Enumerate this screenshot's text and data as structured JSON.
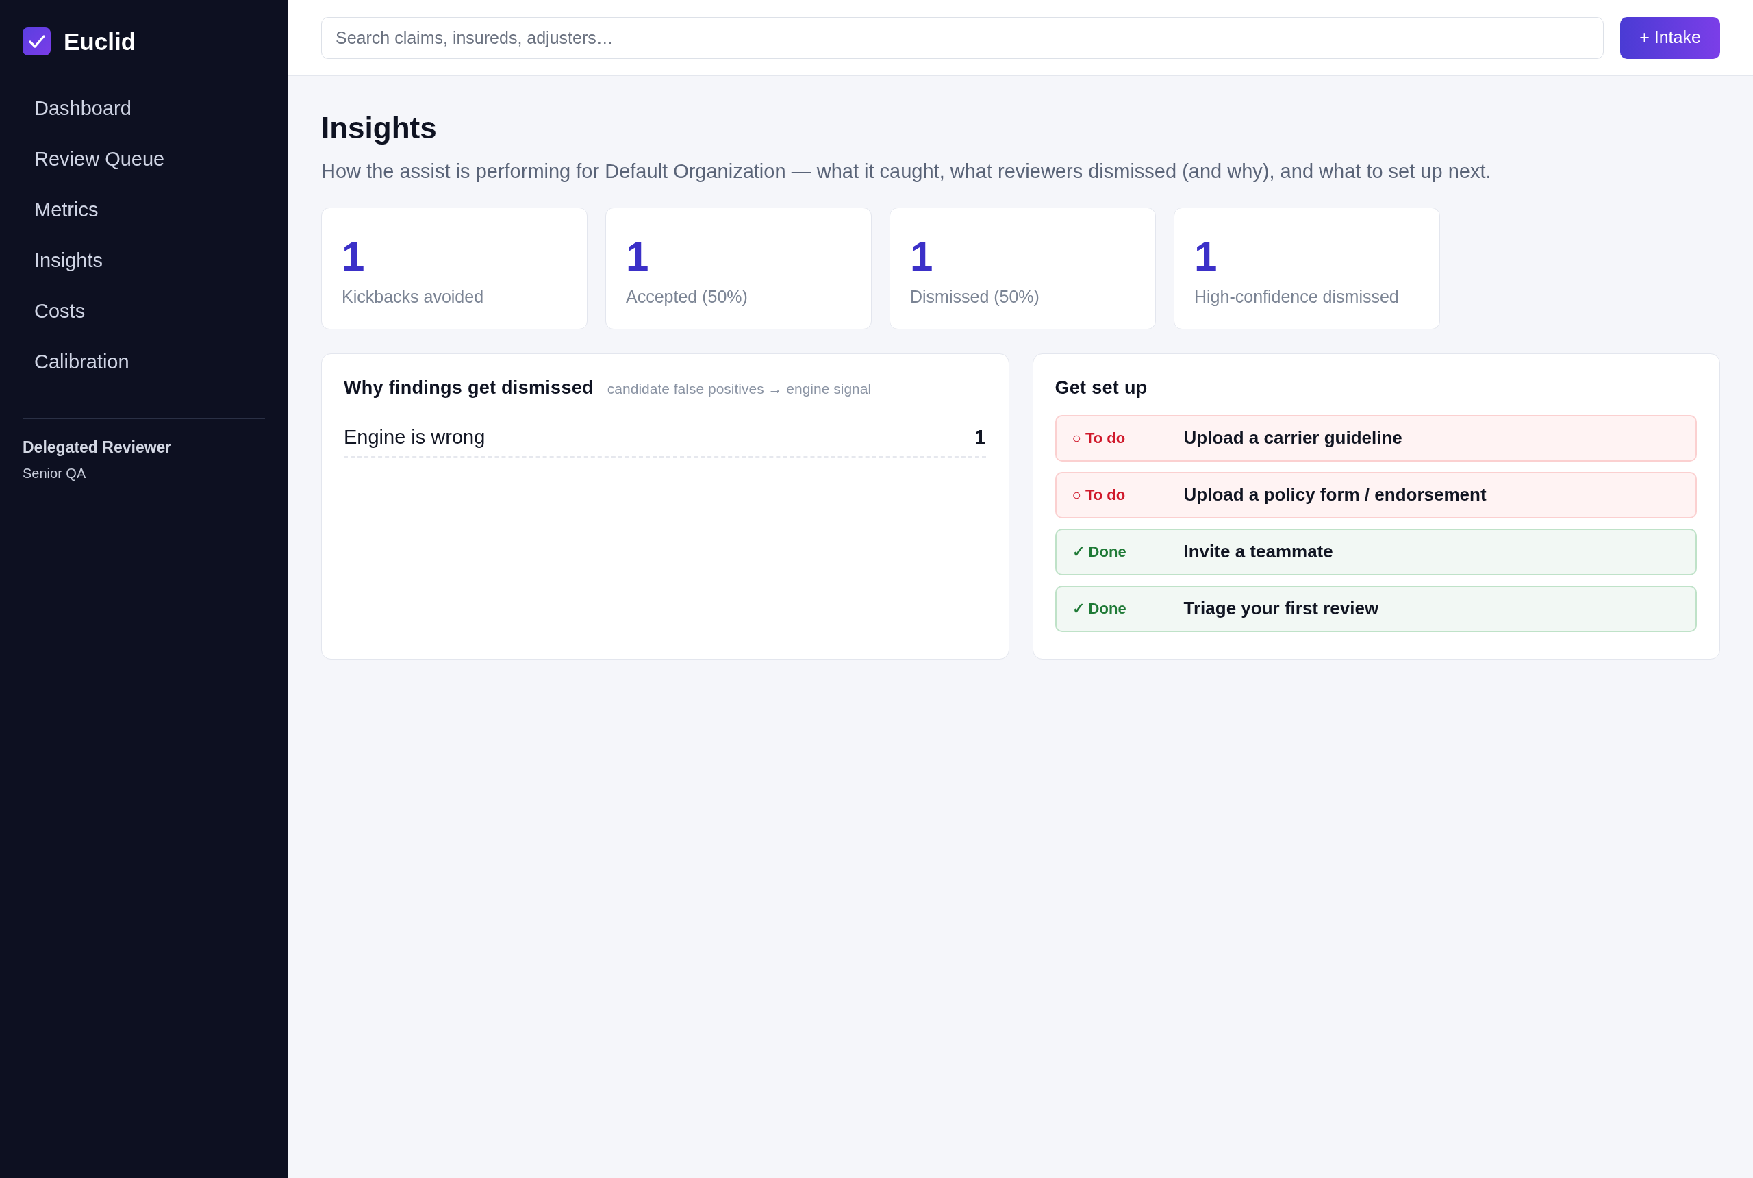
{
  "sidebar": {
    "brand": "Euclid",
    "nav": [
      {
        "label": "Dashboard",
        "selected": false
      },
      {
        "label": "Review Queue",
        "selected": false
      },
      {
        "label": "Metrics",
        "selected": false
      },
      {
        "label": "Insights",
        "selected": false
      },
      {
        "label": "Costs",
        "selected": false
      },
      {
        "label": "Calibration",
        "selected": false
      }
    ],
    "user": {
      "name": "Delegated Reviewer",
      "role": "Senior QA"
    }
  },
  "topbar": {
    "search": {
      "placeholder": "Search claims, insureds, adjusters…"
    },
    "action": "+ Intake"
  },
  "page": {
    "title": "Insights",
    "subtitle": "How the assist is performing for Default Organization — what it caught, what reviewers dismissed (and why), and what to set up next."
  },
  "stats": [
    {
      "value": "1",
      "label": "Kickbacks avoided"
    },
    {
      "value": "1",
      "label": "Accepted (50%)"
    },
    {
      "value": "1",
      "label": "Dismissed (50%)"
    },
    {
      "value": "1",
      "label": "High-confidence dismissed"
    }
  ],
  "dismissals": {
    "title": "Why findings get dismissed",
    "subtitle": "candidate false positives → engine signal",
    "rows": [
      {
        "label": "Engine is wrong",
        "count": "1"
      }
    ]
  },
  "setup": {
    "title": "Get set up",
    "items": [
      {
        "status": "○ To do",
        "done": false,
        "label": "Upload a carrier guideline"
      },
      {
        "status": "○ To do",
        "done": false,
        "label": "Upload a policy form / endorsement"
      },
      {
        "status": "✓ Done",
        "done": true,
        "label": "Invite a teammate"
      },
      {
        "status": "✓ Done",
        "done": true,
        "label": "Triage your first review"
      }
    ]
  }
}
